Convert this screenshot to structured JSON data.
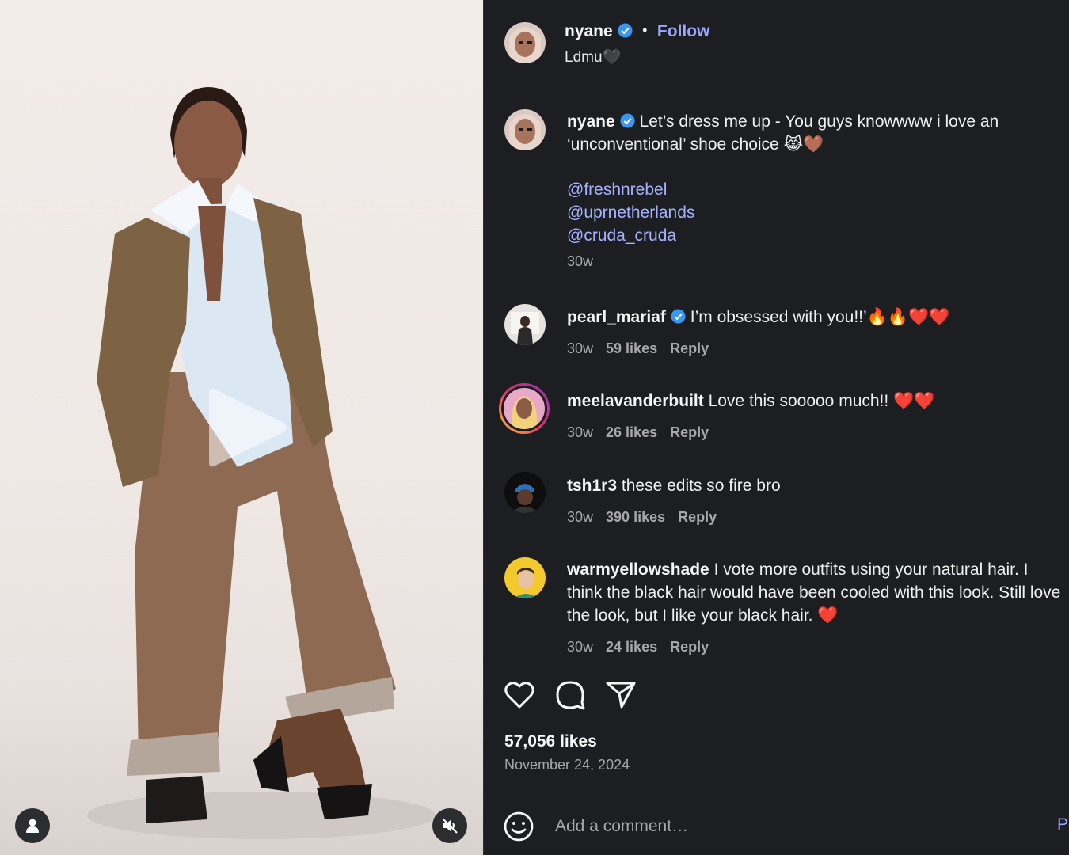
{
  "post": {
    "username": "nyane",
    "follow_label": "Follow",
    "subtitle": "Ldmu🖤",
    "caption_text": "Let’s dress me up - You guys knowwww i love an ‘unconventional’ shoe choice 😹🤎",
    "mentions": [
      "@freshnrebel",
      "@uprnetherlands",
      "@cruda_cruda"
    ],
    "caption_time": "30w"
  },
  "comments": [
    {
      "username": "pearl_mariaf",
      "verified": true,
      "text": "I’m obsessed with you!!’🔥🔥❤️❤️",
      "time": "30w",
      "likes": "59 likes",
      "reply": "Reply"
    },
    {
      "username": "meelavanderbuilt",
      "verified": false,
      "text": "Love this sooooo much!! ❤️❤️",
      "time": "30w",
      "likes": "26 likes",
      "reply": "Reply"
    },
    {
      "username": "tsh1r3",
      "verified": false,
      "text": "these edits so fire bro",
      "time": "30w",
      "likes": "390 likes",
      "reply": "Reply"
    },
    {
      "username": "warmyellowshade",
      "verified": false,
      "text": "I vote more outfits using your natural hair. I think the black hair would have been cooled with this look. Still love the look, but I like your black hair. ❤️",
      "time": "30w",
      "likes": "24 likes",
      "reply": "Reply"
    }
  ],
  "footer": {
    "likes": "57,056 likes",
    "date": "November 24, 2024",
    "comment_placeholder": "Add a comment…",
    "post_label": "Post"
  },
  "icons": {
    "like": "heart-icon",
    "comment": "speech-bubble-icon",
    "share": "paper-plane-icon",
    "emoji": "smiley-icon",
    "user": "person-icon",
    "mute": "speaker-muted-icon",
    "play": "play-icon",
    "verified": "verified-badge-icon"
  },
  "colors": {
    "background": "#1c1e22",
    "link": "#9aa6ff",
    "mention": "#a7b2ff",
    "verified": "#3897f0",
    "secondary_text": "#a8a8a8"
  }
}
